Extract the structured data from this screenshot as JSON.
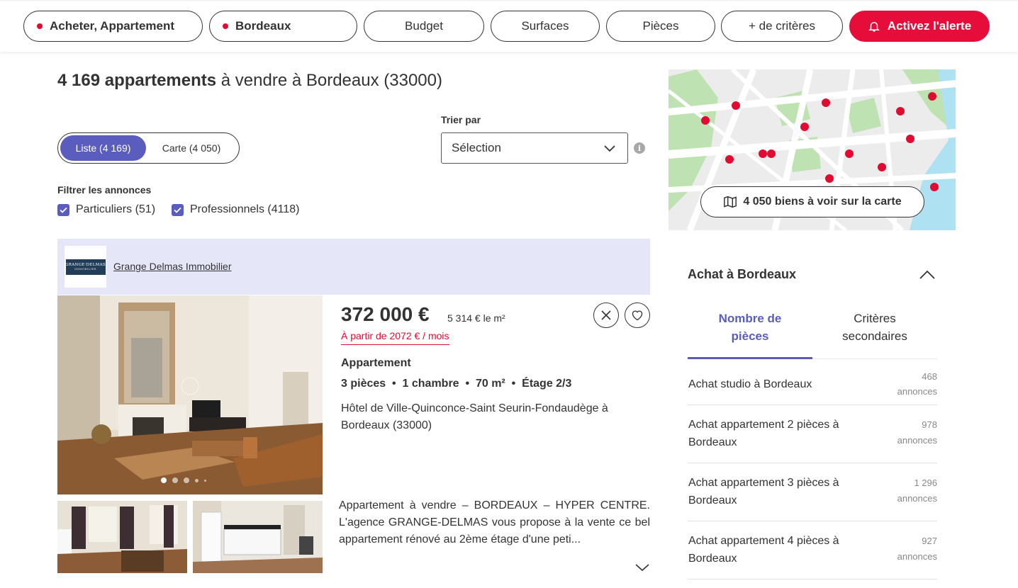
{
  "topbar": {
    "transaction": "Acheter, Appartement",
    "city": "Bordeaux",
    "budget": "Budget",
    "surfaces": "Surfaces",
    "pieces": "Pièces",
    "more": "+ de critères",
    "alert": "Activez l'alerte"
  },
  "results": {
    "count_bold": "4 169 appartements",
    "count_rest": " à vendre à Bordeaux (33000)"
  },
  "view_toggle": {
    "list": "Liste (4 169)",
    "map": "Carte  (4 050)"
  },
  "sort": {
    "label": "Trier par",
    "value": "Sélection",
    "info": "i"
  },
  "filters": {
    "title": "Filtrer les annonces",
    "particuliers": "Particuliers (51)",
    "professionnels": "Professionnels (4118)"
  },
  "agency": {
    "name": "Grange Delmas Immobilier",
    "logo_text_1": "GRANGE·DELMAS",
    "logo_text_2": "IMMOBILIER"
  },
  "listing": {
    "price": "372 000 €",
    "price_m2": "5 314 € le m²",
    "monthly": "À partir de 2072 € / mois",
    "type": "Appartement",
    "specs": "3 pièces  •  1 chambre  •  70 m²  •  Étage 2/3",
    "address": "Hôtel de Ville-Quinconce-Saint Seurin-Fondaudège à Bordeaux (33000)",
    "description": "Appartement à vendre – BORDEAUX – HYPER CENTRE. L'agence GRANGE-DELMAS vous propose à la vente ce bel appartement rénové au 2ème étage d'une peti...",
    "photo_count": 5,
    "current_photo": 1
  },
  "map": {
    "button": "4 050 biens à voir sur la carte",
    "pin_color": "#e10b32"
  },
  "sidebar": {
    "title": "Achat à Bordeaux",
    "tab_active": "Nombre de pièces",
    "tab_inactive": "Critères secondaires",
    "items": [
      {
        "label": "Achat studio à Bordeaux",
        "count": "468",
        "unit": "annonces"
      },
      {
        "label": "Achat appartement 2 pièces à Bordeaux",
        "count": "978",
        "unit": "annonces"
      },
      {
        "label": "Achat appartement 3 pièces à Bordeaux",
        "count": "1 296",
        "unit": "annonces"
      },
      {
        "label": "Achat appartement 4 pièces à Bordeaux",
        "count": "927",
        "unit": "annonces"
      }
    ]
  },
  "colors": {
    "accent": "#5a5dbe",
    "brand_red": "#e10b32",
    "agency_bg": "#e6e6f9"
  }
}
